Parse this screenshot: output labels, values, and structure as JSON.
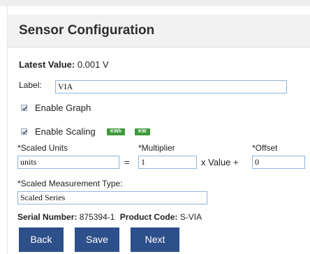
{
  "header": {
    "title": "Sensor Configuration"
  },
  "latest": {
    "label": "Latest Value:",
    "value": "0.001 V"
  },
  "label_field": {
    "label": "Label:",
    "value": "VIA"
  },
  "graph": {
    "label": "Enable Graph",
    "checked": true
  },
  "scaling": {
    "label": "Enable Scaling",
    "checked": true,
    "badges": [
      "KWh",
      "KW"
    ],
    "badge_color": "#3f9a3b"
  },
  "scaled_units": {
    "label": "*Scaled Units",
    "value": "units"
  },
  "equals": "=",
  "multiplier": {
    "label": "*Multiplier",
    "value": "1"
  },
  "times_value": "x Value +",
  "offset": {
    "label": "*Offset",
    "value": "0"
  },
  "measurement_type": {
    "label": "*Scaled Measurement Type:",
    "value": "Scaled Series"
  },
  "info": {
    "serial_label": "Serial Number:",
    "serial_value": "875394-1",
    "product_label": "Product Code:",
    "product_value": "S-VIA"
  },
  "buttons": {
    "back": "Back",
    "save": "Save",
    "next": "Next",
    "color": "#2d4f8a"
  }
}
